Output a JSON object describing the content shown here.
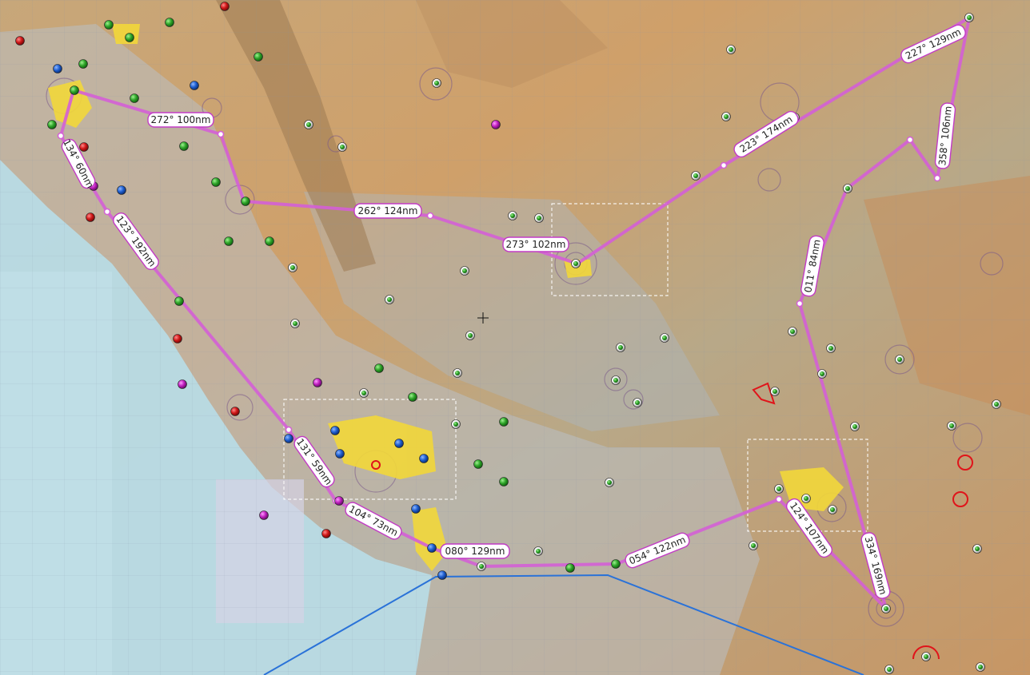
{
  "map": {
    "colors": {
      "route": "#d45fd6",
      "route_label_border": "#c23bc5",
      "airport_green": "#2fa52a",
      "airport_red": "#d01818",
      "airport_blue": "#1f5fd0",
      "airport_magenta": "#c020c0",
      "airport_white": "#f4f4f4",
      "boundary_blue": "#2a72d8",
      "ocean": "#b8dce6",
      "terrain": "#c9a574"
    },
    "route_legs": [
      {
        "label": "272° 100nm"
      },
      {
        "label": "134° 60nm"
      },
      {
        "label": "123° 192nm"
      },
      {
        "label": "262° 124nm"
      },
      {
        "label": "273° 102nm"
      },
      {
        "label": "223° 174nm"
      },
      {
        "label": "227° 129nm"
      },
      {
        "label": "358° 106nm"
      },
      {
        "label": "011° 84nm"
      },
      {
        "label": "131° 59nm"
      },
      {
        "label": "104° 73nm"
      },
      {
        "label": "080° 129nm"
      },
      {
        "label": "054° 122nm"
      },
      {
        "label": "124° 107nm"
      },
      {
        "label": "334° 169nm"
      }
    ],
    "airport_markers": [
      {
        "icon": "green-airport-icon"
      },
      {
        "icon": "red-airport-icon"
      },
      {
        "icon": "blue-airport-icon"
      },
      {
        "icon": "magenta-airport-icon"
      },
      {
        "icon": "white-green-airport-icon"
      }
    ],
    "cursor": {
      "icon": "crosshair-icon"
    }
  }
}
